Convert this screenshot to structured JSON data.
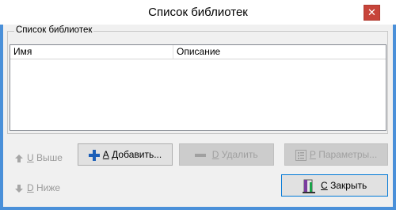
{
  "window": {
    "title": "Список библиотек"
  },
  "group": {
    "label": "Список библиотек"
  },
  "list": {
    "columns": [
      "Имя",
      "Описание"
    ],
    "rows": []
  },
  "buttons": {
    "up": {
      "hotkey": "U",
      "label": "Выше"
    },
    "down": {
      "hotkey": "D",
      "label": "Ниже"
    },
    "add": {
      "hotkey": "A",
      "label": "Добавить..."
    },
    "delete": {
      "hotkey": "D",
      "label": "Удалить"
    },
    "params": {
      "hotkey": "P",
      "label": "Параметры..."
    },
    "close": {
      "hotkey": "C",
      "label": "Закрыть"
    }
  },
  "colors": {
    "accent": "#0078d7",
    "close_button": "#c7443a",
    "add_plus": "#1c5fb8"
  },
  "icons": {
    "up": "arrow-up-icon",
    "down": "arrow-down-icon",
    "add": "plus-icon",
    "delete": "minus-icon",
    "params": "list-settings-icon",
    "close": "exit-door-icon",
    "window_close": "close-icon"
  }
}
